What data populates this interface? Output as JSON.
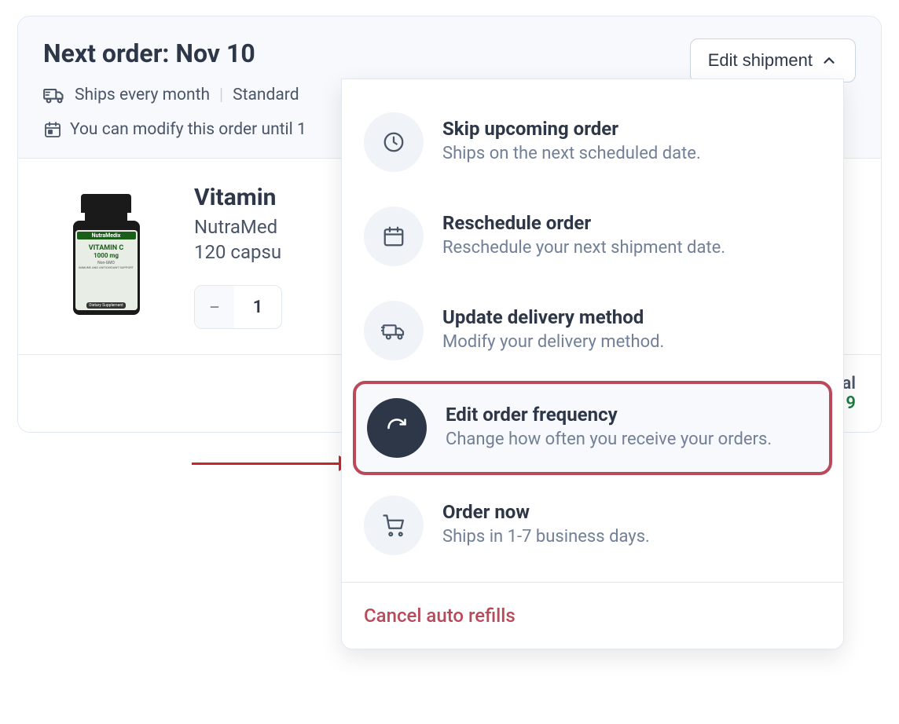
{
  "header": {
    "title": "Next order: Nov 10",
    "edit_button_label": "Edit shipment",
    "ships_label": "Ships every month",
    "shipping_speed": "Standard",
    "modify_label": "You can modify this order until 1"
  },
  "product": {
    "name": "Vitamin",
    "brand": "NutraMed",
    "size": "120 capsu",
    "quantity": 1,
    "bottle_label_brand": "NutraMedix",
    "bottle_label_product": "VITAMIN C",
    "bottle_label_dose": "1000 mg",
    "bottle_label_note1": "Non-GMO",
    "bottle_label_note2": "IMMUNE AND ANTIOXIDANT SUPPORT",
    "bottle_label_supplement": "Dietary Supplement"
  },
  "footer": {
    "subtotal_label_suffix": "tal",
    "subtotal_value_suffix": "9"
  },
  "dropdown": {
    "items": [
      {
        "title": "Skip upcoming order",
        "desc": "Ships on the next scheduled date."
      },
      {
        "title": "Reschedule order",
        "desc": "Reschedule your next shipment date."
      },
      {
        "title": "Update delivery method",
        "desc": "Modify your delivery method."
      },
      {
        "title": "Edit order frequency",
        "desc": "Change how often you receive your orders."
      },
      {
        "title": "Order now",
        "desc": "Ships in 1-7 business days."
      }
    ],
    "cancel_label": "Cancel auto refills"
  },
  "colors": {
    "highlight_border": "#b94a5a",
    "arrow": "#c7262c",
    "dark_icon_bg": "#2d3748",
    "subtotal_green": "#1a7a3e"
  }
}
